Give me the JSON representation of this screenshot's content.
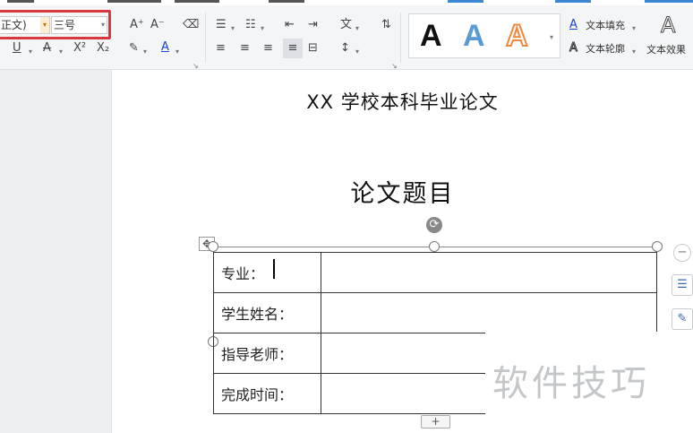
{
  "ribbon": {
    "font_name_value": "正文)",
    "font_size_value": "三号",
    "grow_font_icon": "A⁺",
    "shrink_font_icon": "A⁻",
    "clear_format_icon": "⌫",
    "underline_icon": "U",
    "strike_icon": "A",
    "superscript_icon": "X²",
    "subscript_icon": "X₂",
    "highlight_icon": "✎",
    "font_color_icon": "A",
    "bullet_list_icon": "☰",
    "number_list_icon": "☷",
    "decrease_indent_icon": "⇤",
    "increase_indent_icon": "⇥",
    "chinese_layout_icon": "文",
    "sort_icon": "⇅",
    "align_left_icon": "≡",
    "align_center_icon": "≡",
    "align_right_icon": "≡",
    "justify_icon": "≡",
    "distribute_icon": "⊟",
    "line_spacing_icon": "↕",
    "style_a_black": "A",
    "style_a_blue": "A",
    "style_a_orange": "A",
    "text_fill_label": "文本填充",
    "text_outline_label": "文本轮廓",
    "text_effect_label": "文本效果",
    "text_effect_icon": "A"
  },
  "document": {
    "header_title": "XX 学校本科毕业论文",
    "title": "论文题目",
    "table_rows": [
      {
        "label": "专业："
      },
      {
        "label": "学生姓名："
      },
      {
        "label": "指导老师："
      },
      {
        "label": "完成时间："
      }
    ],
    "add_row_icon": "+",
    "move_icon": "✥",
    "rotate_icon": "⟳"
  },
  "watermark": "软件技巧",
  "side_tools": {
    "collapse_icon": "−",
    "layout_icon": "☰",
    "pen_icon": "✎"
  },
  "colors": {
    "highlight_box": "#d9393d",
    "accent_blue": "#3a87d6",
    "style_orange": "#f0883e"
  }
}
